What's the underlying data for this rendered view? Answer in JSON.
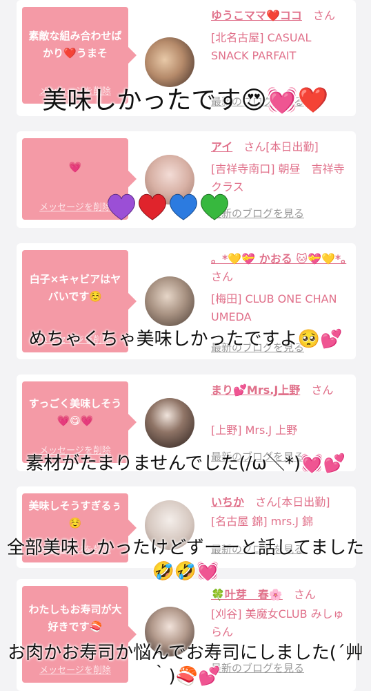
{
  "cards": [
    {
      "message": "素敵な組み合わせばかり❤️うまそ",
      "delete_label": "メッセージを削除",
      "name": "ゆうこママ❤️ココ",
      "honorific": "さん",
      "location": "[北名古屋] CASUAL SNACK PARFAIT",
      "blog_label": "最新のブログを見る"
    },
    {
      "message": "💗",
      "delete_label": "メッセージを削除",
      "name": "アイ",
      "honorific": "さん[本日出勤]",
      "location": "[吉祥寺南口] 朝昼　吉祥寺クラス",
      "blog_label": "最新のブログを見る"
    },
    {
      "message": "白子×キャビアはヤバいです☺️",
      "delete_label": "メッセージを削除",
      "name": "。*💛💝 かおる 🐱💝💛*。",
      "honorific": "さん",
      "location": "[梅田] CLUB ONE CHAN UMEDA",
      "blog_label": "最新のブログを見る"
    },
    {
      "message": "すっごく美味しそう💗😋💗",
      "delete_label": "メッセージを削除",
      "name": "まり💕Mrs.J上野",
      "honorific": "さん",
      "location": "[上野] Mrs.J 上野",
      "blog_label": "最新のブログを見る"
    },
    {
      "message": "美味しそうすぎるぅ☺️",
      "delete_label": "メッセージを削除",
      "name": "いちか",
      "honorific": "さん[本日出勤]",
      "location": "[名古屋 錦] mrs.J 錦",
      "blog_label": "最新のブログを見る"
    },
    {
      "message": "わたしもお寿司が大好きです🍣",
      "delete_label": "メッセージを削除",
      "name": "🍀叶芽　春🌸",
      "honorific": "さん",
      "location": "[刈谷] 美魔女CLUB みしゅらん",
      "blog_label": "最新のブログを見る"
    }
  ],
  "captions": [
    "美味しかったです😍💓❤️",
    "めちゃくちゃ美味しかったですよ🥺💕",
    "素材がたまりませんでした(/ω＼*)💓💕",
    "全部美味しかったけどずーーと話してました🤣🤣💓",
    "お肉かお寿司か悩んでお寿司にしました(´艸｀)🍣💕"
  ],
  "heart_colors": [
    "#9b4fd6",
    "#e0242c",
    "#2c7be0",
    "#37b83e"
  ]
}
